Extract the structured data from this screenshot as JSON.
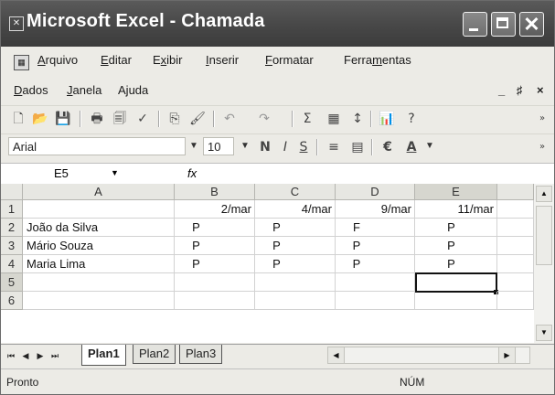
{
  "window": {
    "title": "Microsoft Excel - Chamada",
    "close_glyph": "✕"
  },
  "menu": {
    "items": [
      "Arquivo",
      "Editar",
      "Exibir",
      "Inserir",
      "Formatar",
      "Ferramentas",
      "Dados",
      "Janela",
      "Ajuda"
    ],
    "mdi_controls": [
      "_",
      "♯",
      "×"
    ]
  },
  "toolbar_standard": {
    "icons": [
      "new-icon",
      "open-icon",
      "save-icon",
      "print-icon",
      "print-preview-icon",
      "spelling-icon",
      "copy-icon",
      "format-painter-icon",
      "undo-icon",
      "redo-icon",
      "autosum-icon",
      "chart-icon",
      "sort-icon",
      "drawing-icon",
      "help-icon"
    ],
    "glyphs": [
      "🗋",
      "📂",
      "💾",
      "🖶",
      "🗐",
      "✓",
      "⎘",
      "🖌",
      "↶",
      "↷",
      "Σ",
      "▦",
      "↕",
      "📊",
      "?"
    ]
  },
  "toolbar_formatting": {
    "font_name": "Arial",
    "font_size": "10",
    "bold": "N",
    "italic": "I",
    "underline": "S",
    "euro": "€",
    "font_color": "A"
  },
  "formula_bar": {
    "name_box": "E5",
    "fx": "fx",
    "content": ""
  },
  "sheet": {
    "columns": [
      "A",
      "B",
      "C",
      "D",
      "E"
    ],
    "selected_column": "E",
    "rows": [
      {
        "n": "1",
        "cells": [
          "",
          "2/mar",
          "4/mar",
          "9/mar",
          "11/mar"
        ]
      },
      {
        "n": "2",
        "cells": [
          "João da Silva",
          "P",
          "P",
          "F",
          "P"
        ]
      },
      {
        "n": "3",
        "cells": [
          "Mário Souza",
          "P",
          "P",
          "P",
          "P"
        ]
      },
      {
        "n": "4",
        "cells": [
          "Maria Lima",
          "P",
          "P",
          "P",
          "P"
        ]
      },
      {
        "n": "5",
        "cells": [
          "",
          "",
          "",
          "",
          ""
        ]
      },
      {
        "n": "6",
        "cells": [
          "",
          "",
          "",
          "",
          ""
        ]
      }
    ],
    "active_cell": "E5"
  },
  "tabs": {
    "sheets": [
      "Plan1",
      "Plan2",
      "Plan3"
    ],
    "active": "Plan1"
  },
  "status": {
    "left": "Pronto",
    "num": "NÚM"
  }
}
